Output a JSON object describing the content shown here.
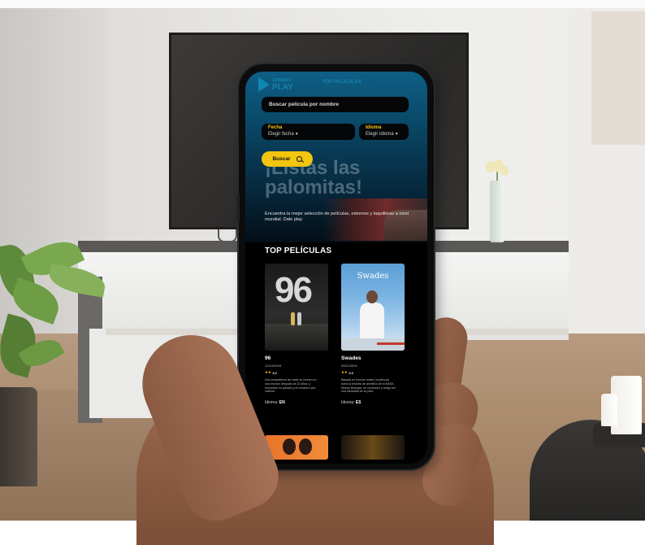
{
  "app": {
    "brand": [
      "CINEMA",
      "PLAY"
    ],
    "nav_link": "TOP PELÍCULAS"
  },
  "search": {
    "placeholder": "Buscar película por nombre"
  },
  "filters": {
    "date_label": "Fecha",
    "date_value": "Elegir fecha",
    "lang_label": "Idioma",
    "lang_value": "Elegir idioma"
  },
  "search_button": "Buscar",
  "hero": {
    "headline": "¡Listas las palomitas!",
    "tagline": "Encuentra la mejor selección de películas, estrenos y taquilleras a nivel mundial. Dale play"
  },
  "section_title": "TOP PELÍCULAS",
  "movies": [
    {
      "poster_text": "96",
      "title": "96",
      "date": "12/10/2018",
      "score": "8.6",
      "description": "Dos compañeros de clase se reúnen en una reunión después de 22 años, y recuerdan su pasado y el romance que vivieron.",
      "lang_label": "Idioma:",
      "lang": "EN"
    },
    {
      "poster_text": "Swades",
      "title": "Swades",
      "date": "09/11/2004",
      "score": "8.0",
      "description": "Basada en hechos reales, la película narra la historia de científico de la NASA Mohan Bhargav, un conductor y amigo sin una identidad de su país.",
      "lang_label": "Idioma:",
      "lang": "ES"
    }
  ],
  "colors": {
    "accent": "#f2c50f",
    "hero_top": "#0e5f86",
    "screen_bg": "#000000",
    "brand": "#1fa5d0"
  }
}
